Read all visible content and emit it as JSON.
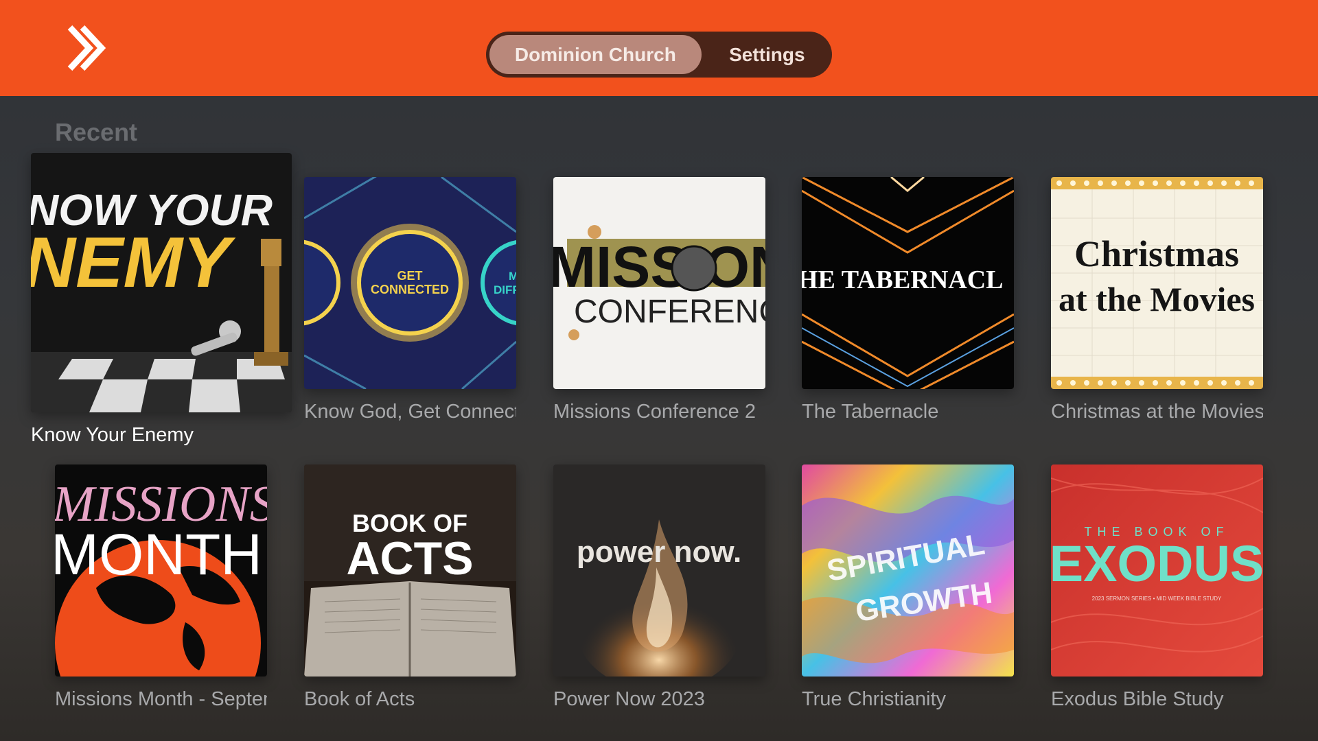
{
  "header": {
    "logo_icon": "forward-chevrons-icon",
    "tabs": [
      {
        "label": "Dominion Church",
        "active": true
      },
      {
        "label": "Settings",
        "active": false
      }
    ],
    "accent_color": "#f2511d"
  },
  "recent": {
    "title": "Recent",
    "items": [
      {
        "caption": "Know Your Enemy",
        "art_text": [
          "NOW YOUR",
          "NEMY"
        ],
        "focused": true
      },
      {
        "caption": "Know God, Get Connected",
        "art_text": [
          "GET",
          "CONNECTED",
          "M",
          "DIFF"
        ]
      },
      {
        "caption": "Missions Conference 2",
        "art_text": [
          "MISSIONS",
          "CONFERENCE"
        ]
      },
      {
        "caption": "The Tabernacle",
        "art_text": [
          "HE TABERNACL"
        ]
      },
      {
        "caption": "Christmas at the Movies",
        "art_text": [
          "Christmas",
          "at the Movies"
        ]
      },
      {
        "caption": "Missions Month - September",
        "art_text": [
          "MISSIONS",
          "MONTH"
        ]
      },
      {
        "caption": "Book of Acts",
        "art_text": [
          "BOOK OF",
          "ACTS"
        ]
      },
      {
        "caption": "Power Now 2023",
        "art_text": [
          "power now."
        ]
      },
      {
        "caption": "True Christianity",
        "art_text": [
          "SPIRITUAL",
          "GROWTH"
        ]
      },
      {
        "caption": "Exodus Bible Study",
        "art_text": [
          "THE BOOK OF",
          "EXODUS",
          "2023 SERMON SERIES • MID WEEK BIBLE STUDY"
        ]
      }
    ]
  }
}
